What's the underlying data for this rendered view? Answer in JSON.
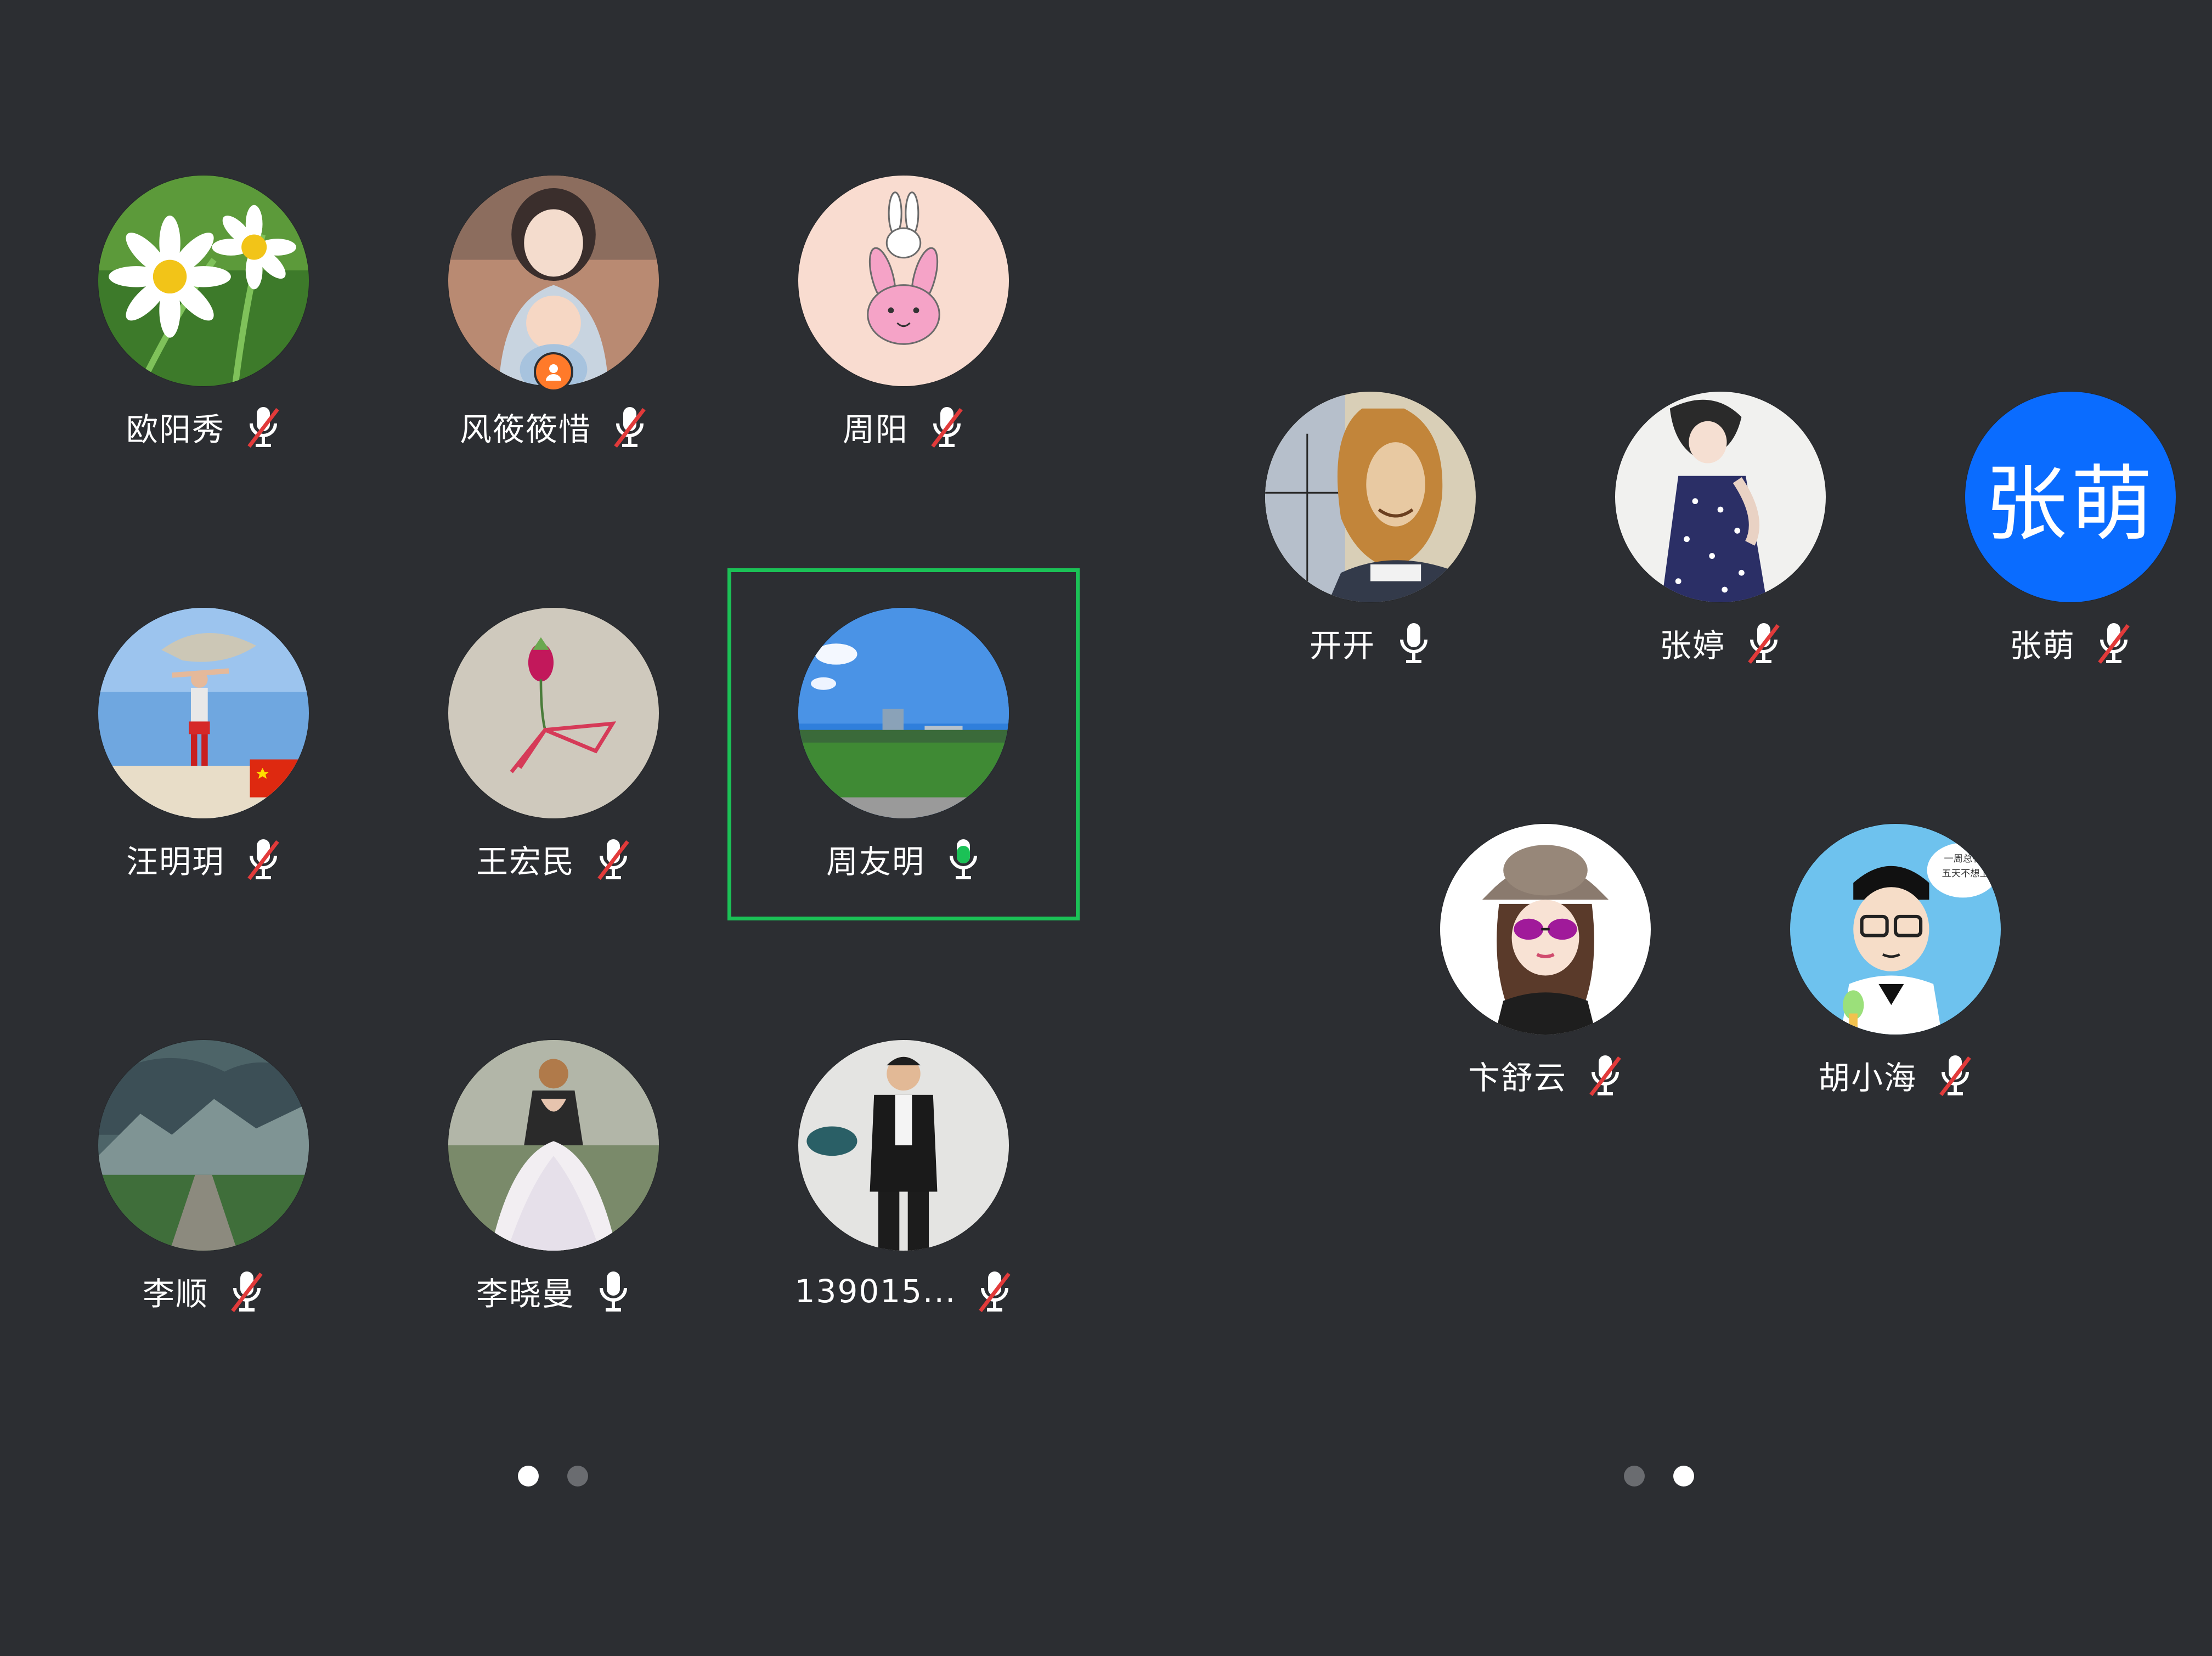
{
  "colors": {
    "background": "#2c2e32",
    "speaking_green": "#1bc156",
    "muted_red": "#e23a3a",
    "text": "#ffffff",
    "zhangmeng_avatar": "#0a6cff"
  },
  "left_page": {
    "participants": [
      {
        "name": "欧阳秀",
        "mic": "muted",
        "avatar": "daisy-flower-photo"
      },
      {
        "name": "风筱筱惜",
        "mic": "muted",
        "avatar": "anime-mother-baby",
        "host": true
      },
      {
        "name": "周阳",
        "mic": "muted",
        "avatar": "pink-bunny-drawing"
      },
      {
        "name": "汪明玥",
        "mic": "muted",
        "avatar": "person-with-flag-sky"
      },
      {
        "name": "王宏民",
        "mic": "muted",
        "avatar": "flower-sketch"
      },
      {
        "name": "周友明",
        "mic": "speaking",
        "avatar": "blue-sky-field",
        "active_speaker": true
      },
      {
        "name": "李顺",
        "mic": "muted",
        "avatar": "mountain-road-landscape"
      },
      {
        "name": "李晓曼",
        "mic": "on",
        "avatar": "woman-wedding-dress"
      },
      {
        "name": "139015...",
        "mic": "muted",
        "avatar": "man-standing-portrait"
      }
    ],
    "pagination": {
      "total": 2,
      "active": 1
    }
  },
  "right_page": {
    "participants": [
      {
        "name": "开开",
        "mic": "on",
        "avatar": "descartes-portrait"
      },
      {
        "name": "张婷",
        "mic": "muted",
        "avatar": "girl-polka-dress"
      },
      {
        "name": "张萌",
        "mic": "muted",
        "avatar": "text-avatar",
        "avatar_text": "张萌"
      },
      {
        "name": "卞舒云",
        "mic": "muted",
        "avatar": "cartoon-girl-sunglasses"
      },
      {
        "name": "胡小海",
        "mic": "muted",
        "avatar": "cartoon-boy-glasses",
        "bubble_text": [
          "一周总有那",
          "五天不想上班"
        ]
      }
    ],
    "pagination": {
      "total": 2,
      "active": 2
    }
  }
}
